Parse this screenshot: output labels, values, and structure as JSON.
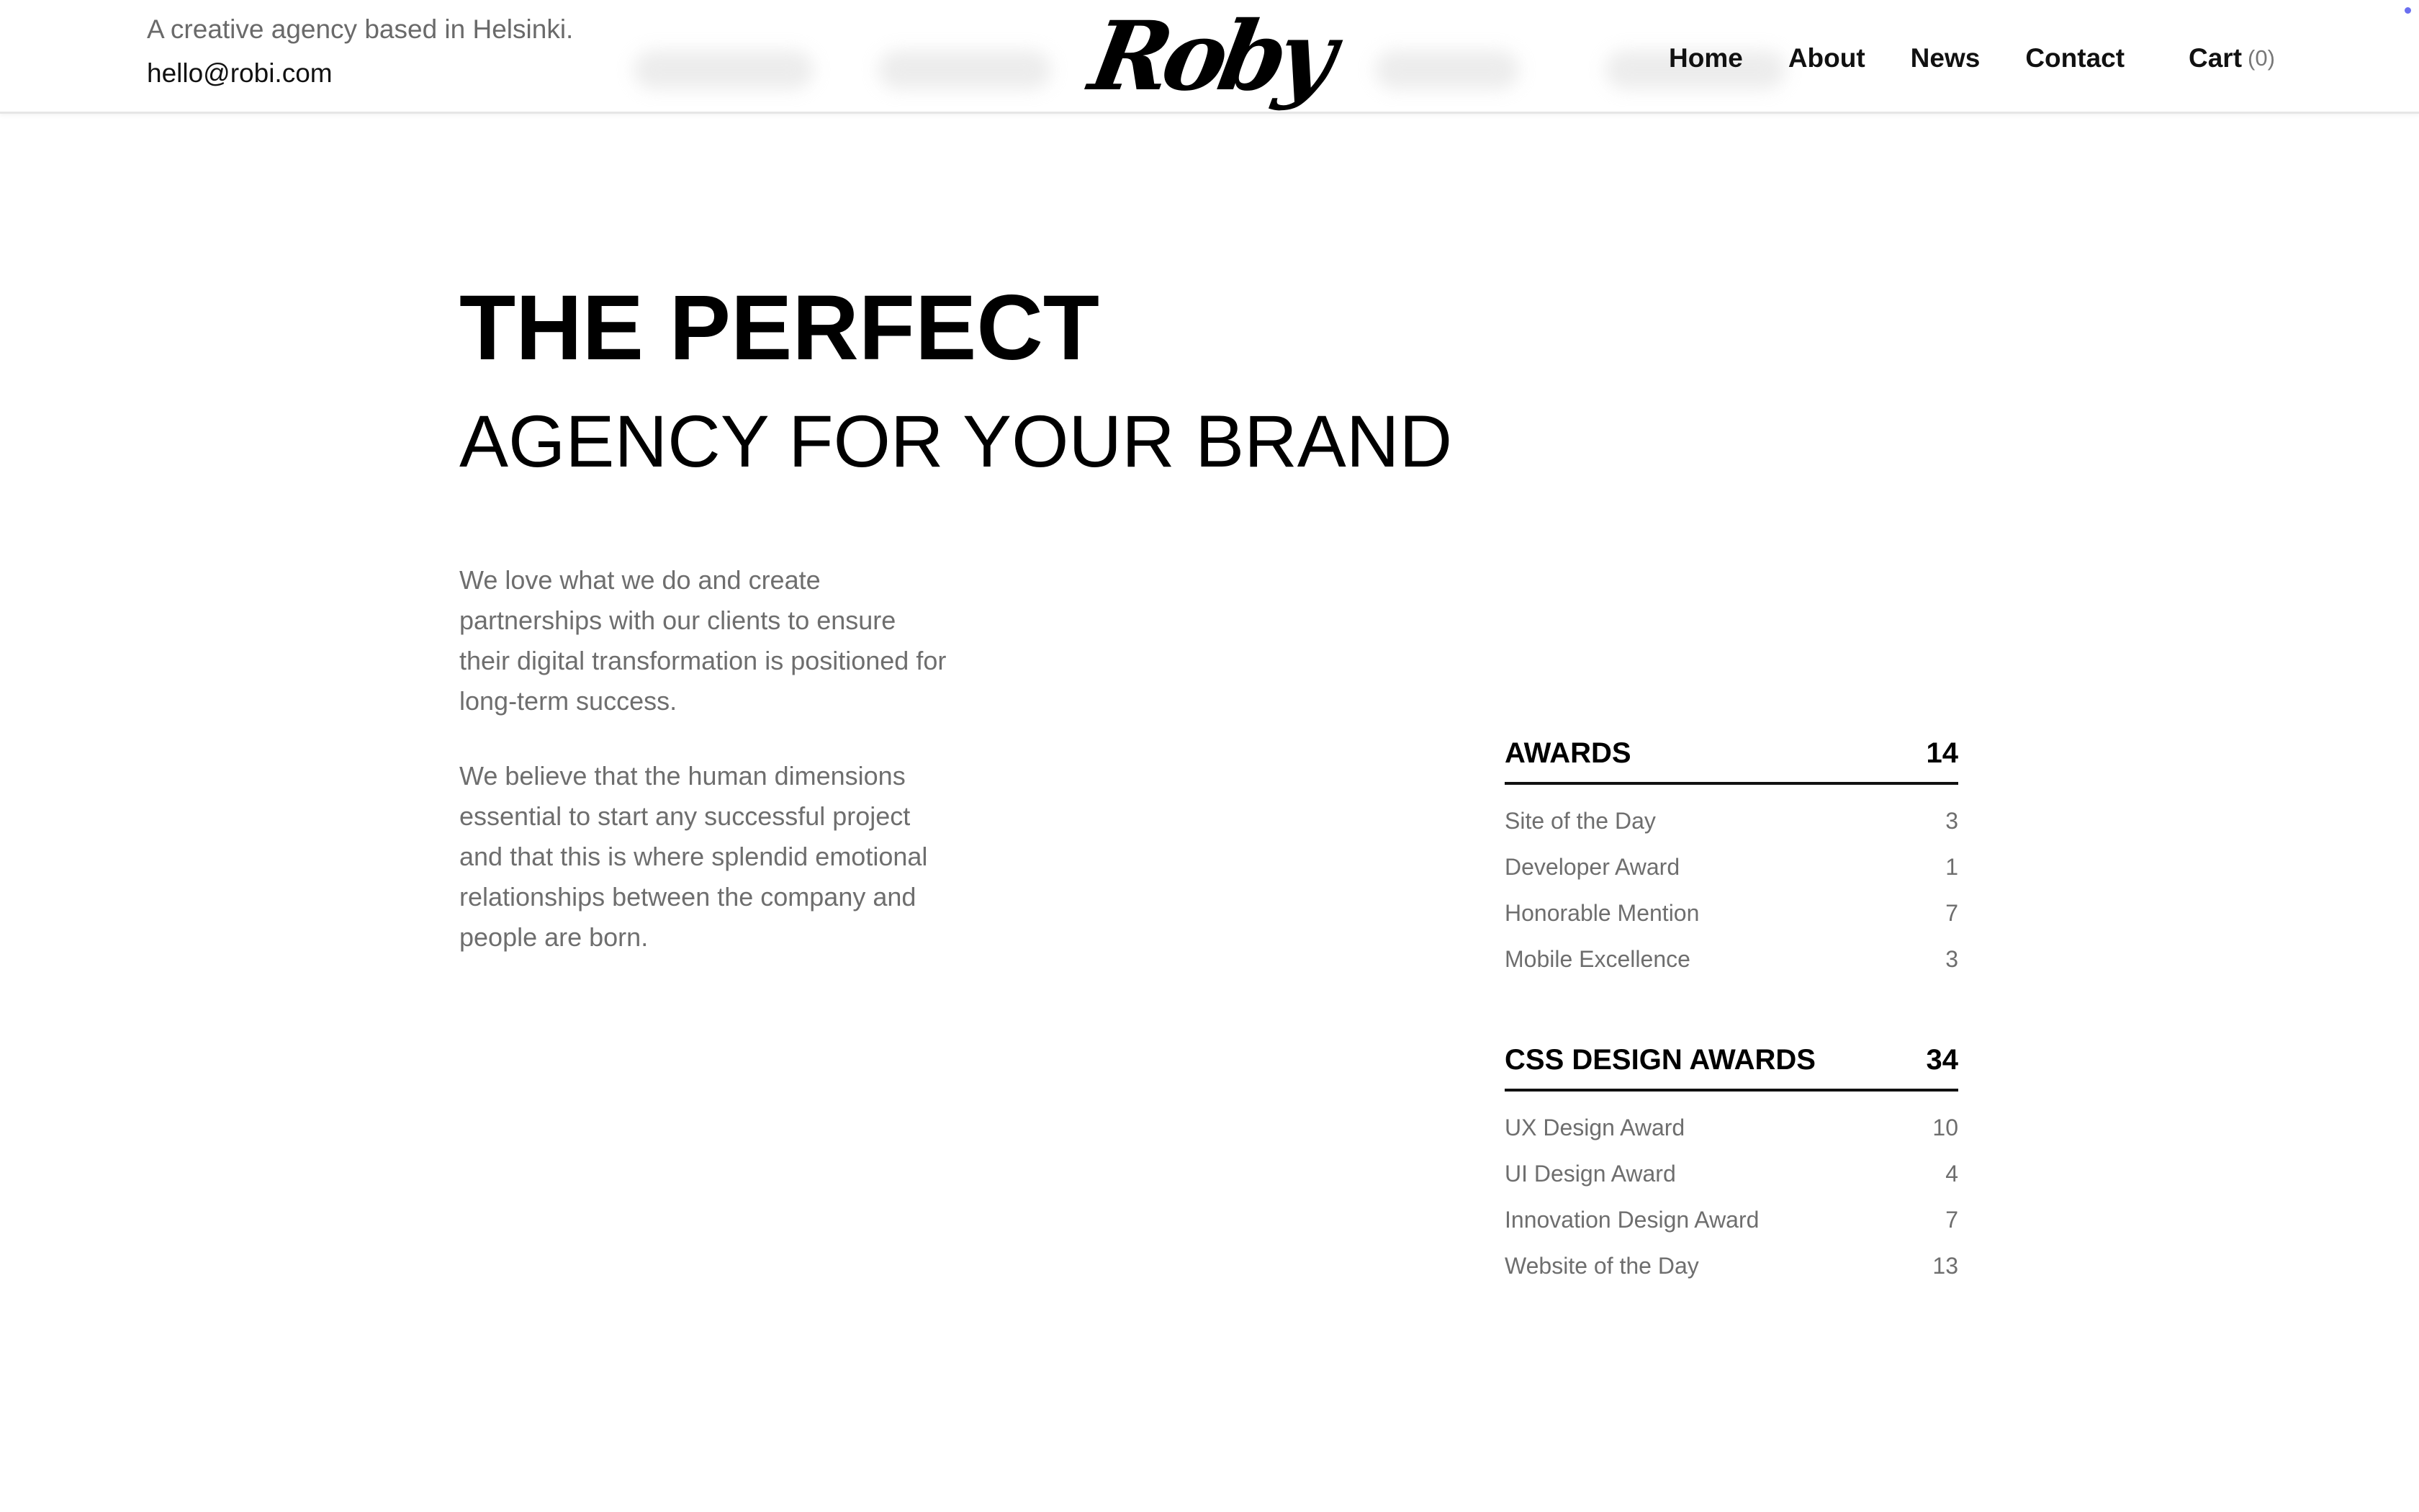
{
  "header": {
    "tagline": "A creative agency based in Helsinki.",
    "email": "hello@robi.com",
    "logo_text": "Roby",
    "nav": [
      {
        "label": "Home"
      },
      {
        "label": "About"
      },
      {
        "label": "News"
      },
      {
        "label": "Contact"
      }
    ],
    "cart": {
      "label": "Cart",
      "count": "(0)"
    }
  },
  "hero": {
    "title_line1": "THE PERFECT",
    "title_line2": "AGENCY FOR YOUR BRAND",
    "paragraphs": [
      "We love what we do and create partnerships with our clients to ensure their digital transformation is positioned for long-term success.",
      "We believe that the human dimensions essential to start any successful project and that this is where splendid emotional relationships between the company and people are born."
    ]
  },
  "award_groups": [
    {
      "title": "AWARDS",
      "total": "14",
      "items": [
        {
          "name": "Site of the Day",
          "count": "3"
        },
        {
          "name": "Developer Award",
          "count": "1"
        },
        {
          "name": "Honorable Mention",
          "count": "7"
        },
        {
          "name": "Mobile Excellence",
          "count": "3"
        }
      ]
    },
    {
      "title": "CSS DESIGN AWARDS",
      "total": "34",
      "items": [
        {
          "name": "UX Design Award",
          "count": "10"
        },
        {
          "name": "UI Design Award",
          "count": "4"
        },
        {
          "name": "Innovation Design Award",
          "count": "7"
        },
        {
          "name": "Website of the Day",
          "count": "13"
        }
      ]
    }
  ],
  "colors": {
    "text_primary": "#000000",
    "text_muted": "#6e6e6e",
    "divider": "#111111",
    "header_border": "#e6e6e6",
    "corner_dot": "#6a6ff0"
  }
}
